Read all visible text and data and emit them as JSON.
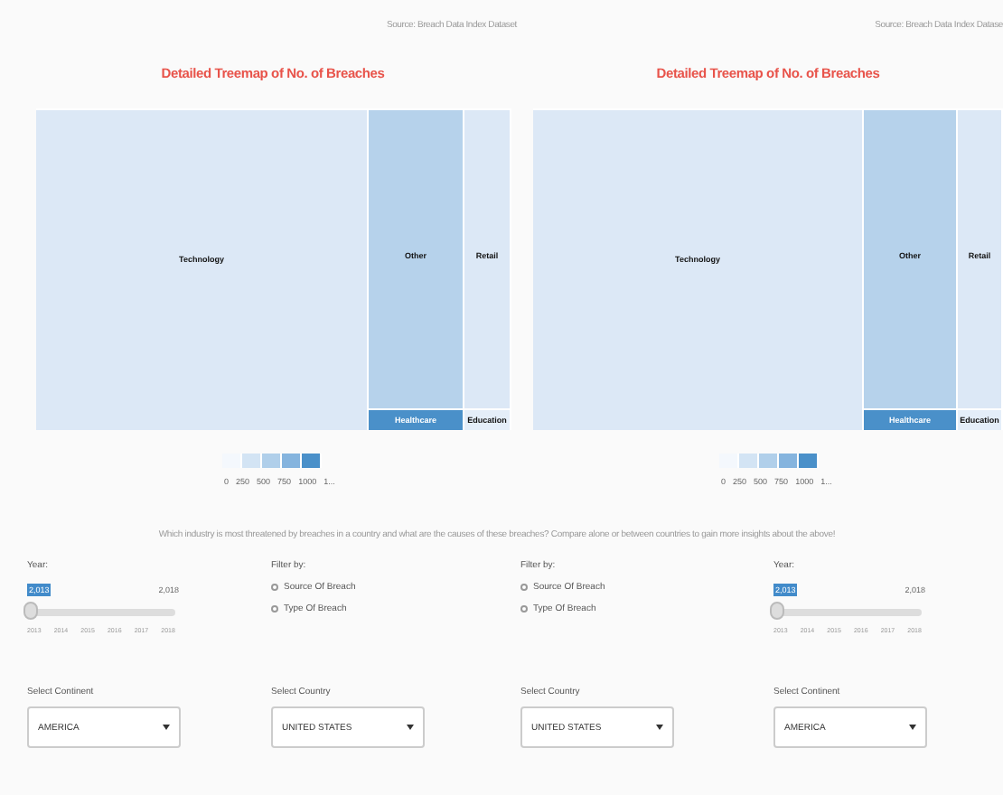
{
  "panels": [
    {
      "source": "Source: Breach Data Index Dataset",
      "title": "Detailed Treemap of No. of Breaches",
      "treemap": {
        "columns": [
          {
            "cells": [
              {
                "label": "Technology",
                "color": "#dce8f6"
              }
            ]
          },
          {
            "cells": [
              {
                "label": "Other",
                "color": "#b6d2eb"
              },
              {
                "label": "Healthcare",
                "color": "#4a90c9"
              }
            ]
          },
          {
            "cells": [
              {
                "label": "Retail",
                "color": "#dce8f6"
              },
              {
                "label": "Education",
                "color": "#e4eef9"
              }
            ]
          }
        ]
      },
      "legend": [
        "0",
        "250",
        "500",
        "750",
        "1000",
        "1..."
      ]
    },
    {
      "source": "Source: Breach Data Index Datase",
      "title": "Detailed Treemap of No. of Breaches",
      "treemap": {
        "columns": [
          {
            "cells": [
              {
                "label": "Technology",
                "color": "#dce8f6"
              }
            ]
          },
          {
            "cells": [
              {
                "label": "Other",
                "color": "#b6d2eb"
              },
              {
                "label": "Healthcare",
                "color": "#4a90c9"
              }
            ]
          },
          {
            "cells": [
              {
                "label": "Retail",
                "color": "#dce8f6"
              },
              {
                "label": "Education",
                "color": "#e4eef9"
              }
            ]
          }
        ]
      },
      "legend": [
        "0",
        "250",
        "500",
        "750",
        "1000",
        "1..."
      ]
    }
  ],
  "question": "Which industry is most threatened by breaches in a country and what are the causes of these breaches? Compare alone or between countries to gain more insights about the above!",
  "controls": [
    {
      "kind": "slider",
      "label": "Year:",
      "value": "2,013",
      "max_label": "2,018",
      "level": 0,
      "ticks": [
        "2013",
        "2014",
        "2015",
        "2016",
        "2017",
        "2018"
      ]
    },
    {
      "kind": "radio",
      "label": "Filter by:",
      "options": [
        {
          "label": "Source Of Breach",
          "selected": false
        },
        {
          "label": "Type Of Breach",
          "selected": false
        }
      ]
    },
    {
      "kind": "radio",
      "label": "Filter by:",
      "options": [
        {
          "label": "Source Of Breach",
          "selected": false
        },
        {
          "label": "Type Of Breach",
          "selected": false
        }
      ]
    },
    {
      "kind": "slider",
      "label": "Year:",
      "value": "2,013",
      "max_label": "2,018",
      "level": 0,
      "ticks": [
        "2013",
        "2014",
        "2015",
        "2016",
        "2017",
        "2018"
      ]
    }
  ],
  "selects": [
    {
      "label": "Select Continent",
      "value": "AMERICA"
    },
    {
      "label": "Select Country",
      "value": "UNITED STATES"
    },
    {
      "label": "Select Country",
      "value": "UNITED STATES"
    },
    {
      "label": "Select Continent",
      "value": "AMERICA"
    }
  ]
}
